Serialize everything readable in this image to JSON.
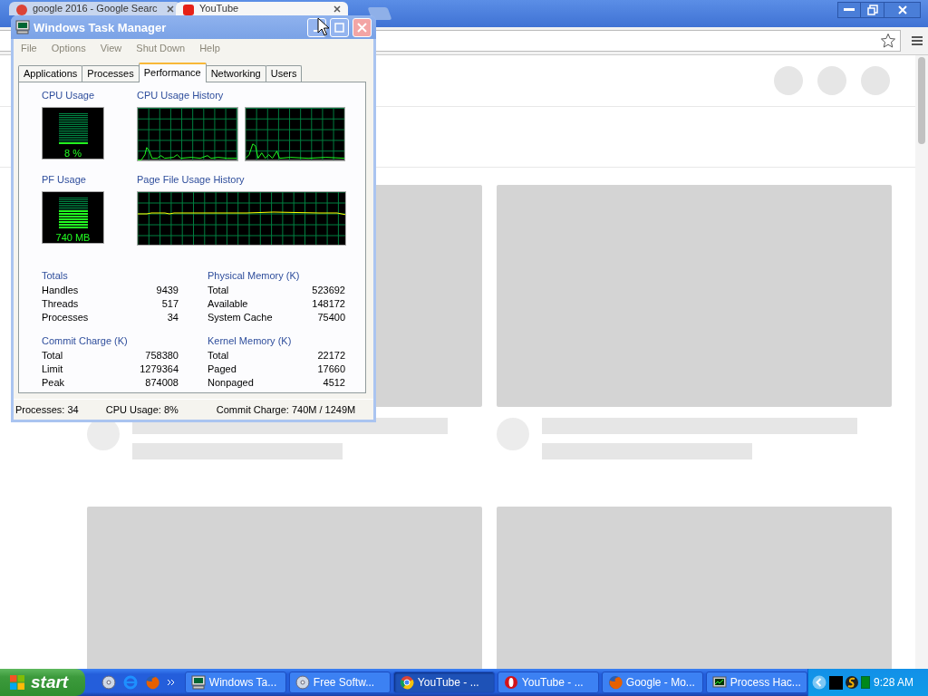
{
  "browser": {
    "tabs": [
      {
        "title": "google 2016 - Google Searc",
        "selected": false
      },
      {
        "title": "YouTube",
        "selected": true
      }
    ]
  },
  "task_manager": {
    "title": "Windows Task Manager",
    "menu": [
      "File",
      "Options",
      "View",
      "Shut Down",
      "Help"
    ],
    "tabs": [
      {
        "label": "Applications",
        "selected": false
      },
      {
        "label": "Processes",
        "selected": false
      },
      {
        "label": "Performance",
        "selected": true
      },
      {
        "label": "Networking",
        "selected": false
      },
      {
        "label": "Users",
        "selected": false
      }
    ],
    "cpu_usage": {
      "label": "CPU Usage",
      "reading": "8 %",
      "level": 0.08
    },
    "cpu_history": {
      "label": "CPU Usage History"
    },
    "pf_usage": {
      "label": "PF Usage",
      "reading": "740 MB",
      "level": 0.59
    },
    "pf_history": {
      "label": "Page File Usage History"
    },
    "groups": [
      {
        "title": "Totals",
        "rows": [
          {
            "name": "Handles",
            "value": "9439"
          },
          {
            "name": "Threads",
            "value": "517"
          },
          {
            "name": "Processes",
            "value": "34"
          }
        ]
      },
      {
        "title": "Physical Memory (K)",
        "rows": [
          {
            "name": "Total",
            "value": "523692"
          },
          {
            "name": "Available",
            "value": "148172"
          },
          {
            "name": "System Cache",
            "value": "75400"
          }
        ]
      },
      {
        "title": "Commit Charge (K)",
        "rows": [
          {
            "name": "Total",
            "value": "758380"
          },
          {
            "name": "Limit",
            "value": "1279364"
          },
          {
            "name": "Peak",
            "value": "874008"
          }
        ]
      },
      {
        "title": "Kernel Memory (K)",
        "rows": [
          {
            "name": "Total",
            "value": "22172"
          },
          {
            "name": "Paged",
            "value": "17660"
          },
          {
            "name": "Nonpaged",
            "value": "4512"
          }
        ]
      }
    ],
    "status_bar": [
      "Processes: 34",
      "CPU Usage: 8%",
      "Commit Charge: 740M / 1249M"
    ]
  },
  "taskbar": {
    "start": "start",
    "tasks": [
      {
        "label": "Windows Ta...",
        "kind": "monitor",
        "selected": false
      },
      {
        "label": "Free Softw...",
        "kind": "disc",
        "selected": false
      },
      {
        "label": "YouTube - ...",
        "kind": "chrome",
        "selected": true
      },
      {
        "label": "YouTube - ...",
        "kind": "opera",
        "selected": false
      },
      {
        "label": "Google - Mo...",
        "kind": "firefox",
        "selected": false
      },
      {
        "label": "Process Hac...",
        "kind": "chart",
        "selected": false
      }
    ],
    "clock": "9:28 AM"
  }
}
